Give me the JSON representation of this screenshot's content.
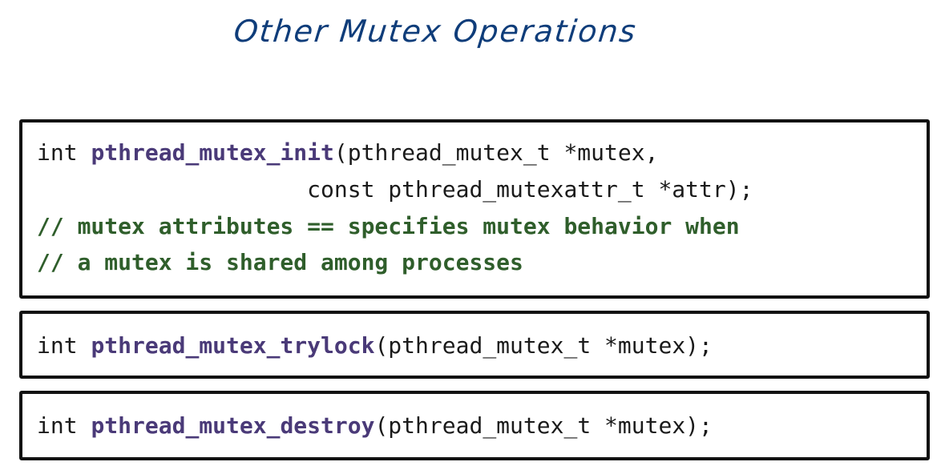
{
  "title": "Other Mutex Operations",
  "colors": {
    "title": "#0f3d7a",
    "function_name": "#4a3a78",
    "comment": "#2f5e2b",
    "code_text": "#1a1a1a",
    "box_border": "#111111"
  },
  "blocks": [
    {
      "name": "init",
      "line1": {
        "prefix": "int ",
        "function": "pthread_mutex_init",
        "suffix": "(pthread_mutex_t *mutex,"
      },
      "line2": "                    const pthread_mutexattr_t *attr);",
      "comments": [
        "// mutex attributes == specifies mutex behavior when",
        "// a mutex is shared among processes"
      ]
    },
    {
      "name": "trylock",
      "line1": {
        "prefix": "int ",
        "function": "pthread_mutex_trylock",
        "suffix": "(pthread_mutex_t *mutex);"
      }
    },
    {
      "name": "destroy",
      "line1": {
        "prefix": "int ",
        "function": "pthread_mutex_destroy",
        "suffix": "(pthread_mutex_t *mutex);"
      }
    }
  ]
}
